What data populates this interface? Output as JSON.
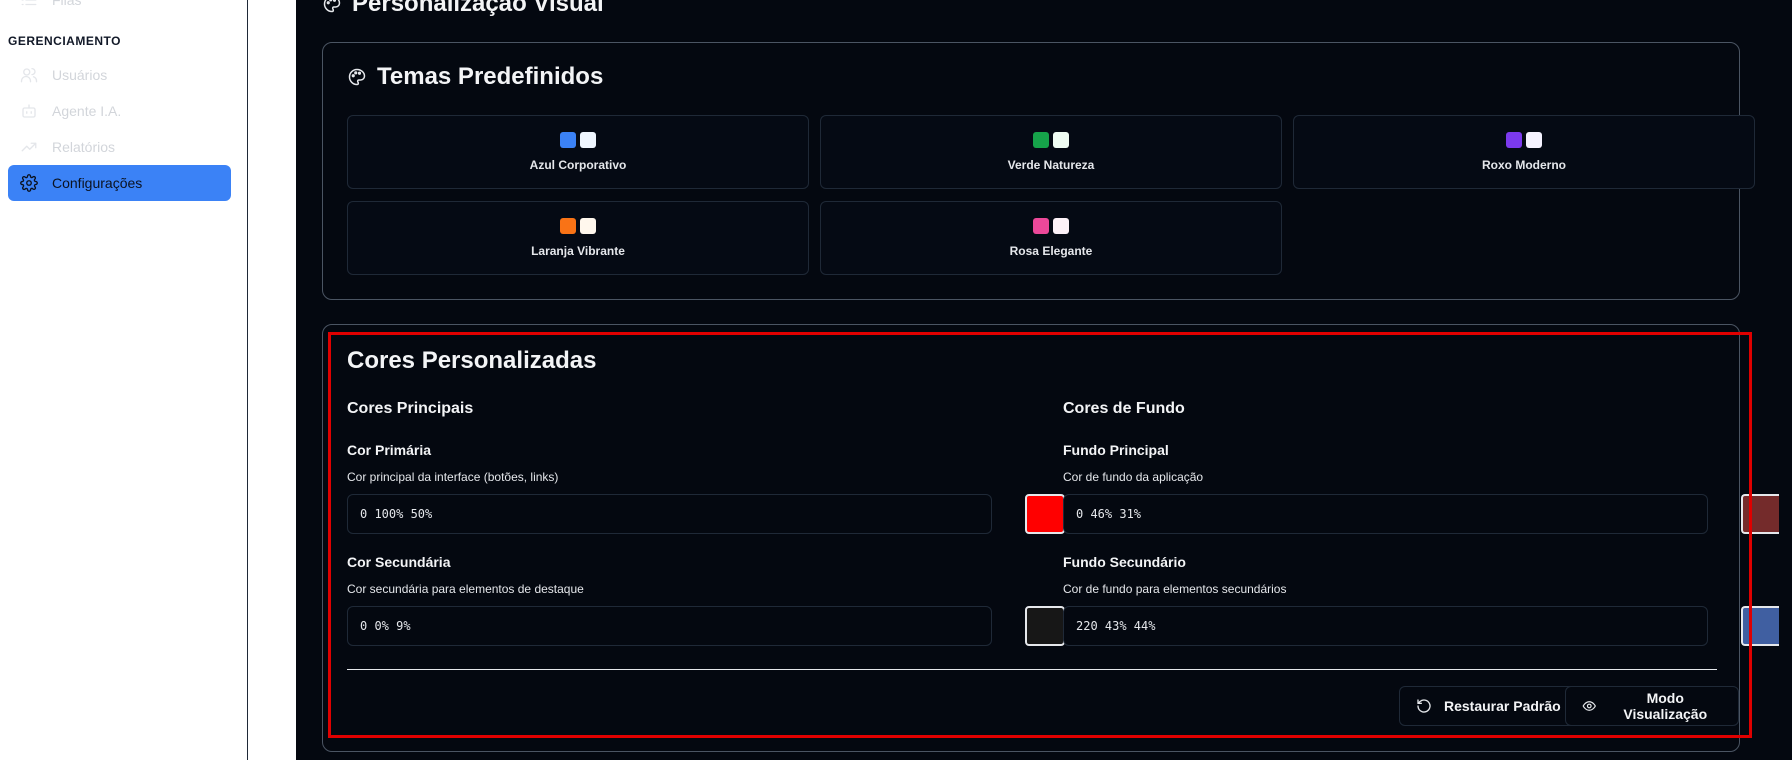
{
  "sidebar": {
    "top_item_label": "Filas",
    "section_label": "GERENCIAMENTO",
    "items": [
      {
        "label": "Usuários",
        "icon": "users-icon"
      },
      {
        "label": "Agente I.A.",
        "icon": "bot-icon"
      },
      {
        "label": "Relatórios",
        "icon": "trending-up-icon"
      },
      {
        "label": "Configurações",
        "icon": "gear-icon",
        "active": true
      }
    ]
  },
  "page": {
    "title": "Personalização Visual"
  },
  "themes": {
    "title": "Temas Predefinidos",
    "items": [
      {
        "name": "Azul Corporativo",
        "primary": "#3b82f6",
        "secondary": "#eff6ff"
      },
      {
        "name": "Verde Natureza",
        "primary": "#16a34a",
        "secondary": "#f0fdf4"
      },
      {
        "name": "Roxo Moderno",
        "primary": "#7c3aed",
        "secondary": "#f5f3ff"
      },
      {
        "name": "Laranja Vibrante",
        "primary": "#f97316",
        "secondary": "#fff7ed"
      },
      {
        "name": "Rosa Elegante",
        "primary": "#ec4899",
        "secondary": "#fdf2f8"
      }
    ]
  },
  "custom_colors": {
    "title": "Cores Personalizadas",
    "main": {
      "heading": "Cores Principais",
      "primary": {
        "label": "Cor Primária",
        "desc": "Cor principal da interface (botões, links)",
        "value": "0 100% 50%",
        "swatch": "#ff0000"
      },
      "secondary": {
        "label": "Cor Secundária",
        "desc": "Cor secundária para elementos de destaque",
        "value": "0 0% 9%",
        "swatch": "#171717"
      }
    },
    "background": {
      "heading": "Cores de Fundo",
      "primary": {
        "label": "Fundo Principal",
        "desc": "Cor de fundo da aplicação",
        "value": "0 46% 31%",
        "swatch": "#742b2b"
      },
      "secondary": {
        "label": "Fundo Secundário",
        "desc": "Cor de fundo para elementos secundários",
        "value": "220 43% 44%",
        "swatch": "#405f a1"
      }
    },
    "buttons": {
      "restore": "Restaurar Padrão",
      "preview": "Modo Visualização"
    }
  },
  "colors": {
    "accent": "#3b82f6",
    "highlight": "#e00000",
    "background": "#040810"
  }
}
